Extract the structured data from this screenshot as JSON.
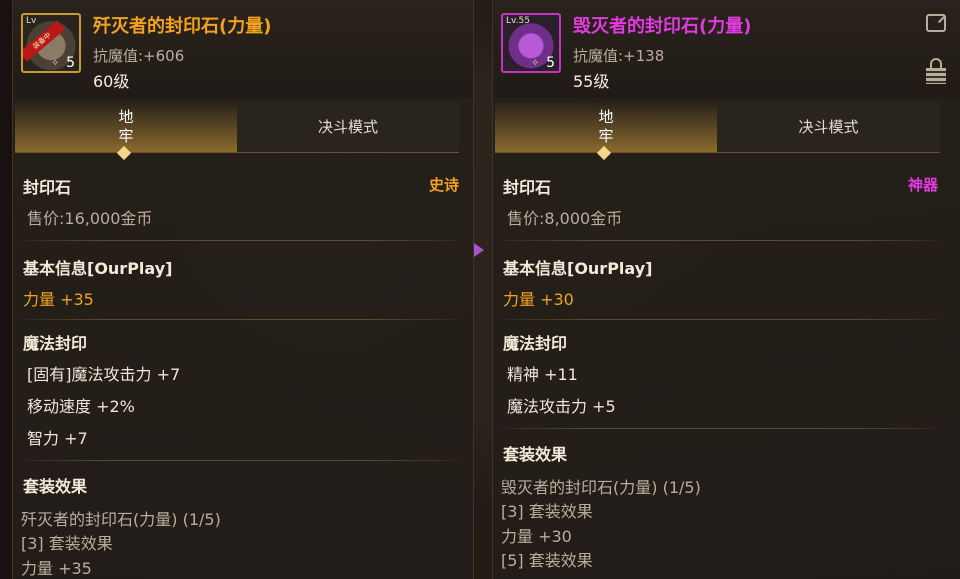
{
  "left": {
    "icon": {
      "level": "Lv",
      "badge": "装备中",
      "count": "5",
      "name": "seal-stone-icon"
    },
    "name": "歼灭者的封印石(力量)",
    "resist": "抗魔值:+606",
    "level": "60级",
    "tabs": [
      "地\n牢",
      "决斗模式"
    ],
    "category": "封印石",
    "grade": "史诗",
    "price": "售价:16,000金币",
    "basic_title": "基本信息[OurPlay]",
    "basic_stat": "力量 +35",
    "magic_title": "魔法封印",
    "magic_stats": [
      "[固有]魔法攻击力 +7",
      "移动速度 +2%",
      "智力 +7"
    ],
    "set_title": "套装效果",
    "set_lines": [
      "歼灭者的封印石(力量) (1/5)",
      "[3] 套装效果",
      "力量 +35"
    ]
  },
  "right": {
    "icon": {
      "level": "Lv.55",
      "count": "5",
      "name": "seal-stone-icon"
    },
    "name": "毁灭者的封印石(力量)",
    "resist": "抗魔值:+138",
    "level": "55级",
    "tabs": [
      "地\n牢",
      "决斗模式"
    ],
    "category": "封印石",
    "grade": "神器",
    "price": "售价:8,000金币",
    "basic_title": "基本信息[OurPlay]",
    "basic_stat": "力量 +30",
    "magic_title": "魔法封印",
    "magic_stats": [
      "精神 +11",
      "魔法攻击力 +5"
    ],
    "set_title": "套装效果",
    "set_lines": [
      "毁灭者的封印石(力量) (1/5)",
      "[3] 套装效果",
      "力量 +30",
      "[5] 套装效果"
    ]
  },
  "colors": {
    "epic": "#f2a21e",
    "artifact": "#e23ae0",
    "accent": "#c99a34"
  }
}
